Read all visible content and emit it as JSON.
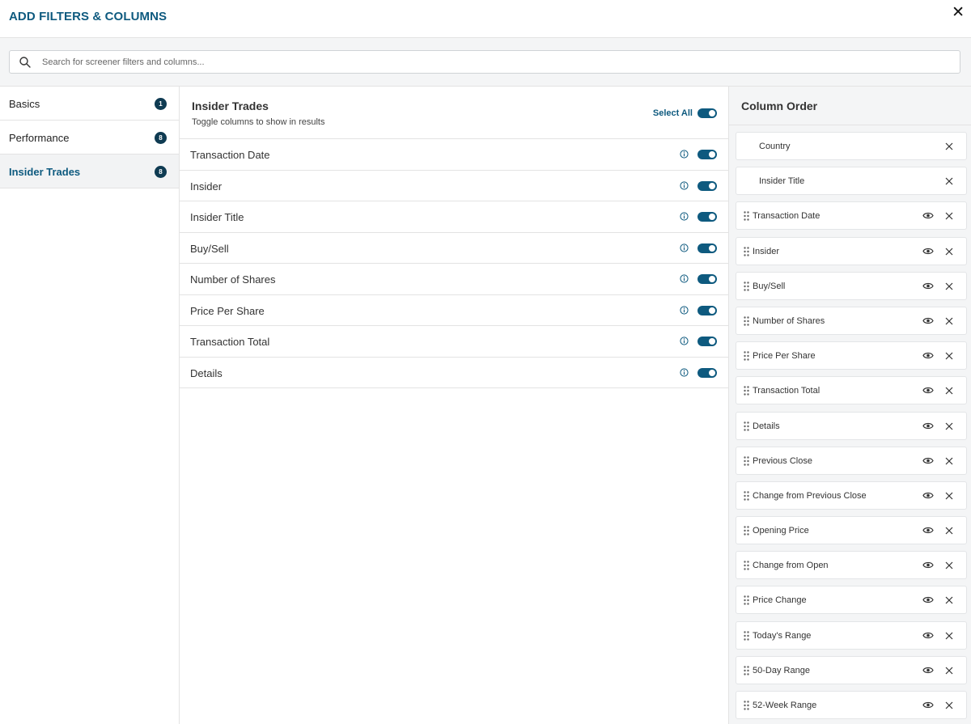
{
  "header": {
    "title": "ADD FILTERS & COLUMNS",
    "close_label": "✕"
  },
  "search": {
    "placeholder": "Search for screener filters and columns..."
  },
  "sidebar": {
    "items": [
      {
        "label": "Basics",
        "count": "1",
        "active": false
      },
      {
        "label": "Performance",
        "count": "8",
        "active": false
      },
      {
        "label": "Insider Trades",
        "count": "8",
        "active": true
      }
    ]
  },
  "middle": {
    "title": "Insider Trades",
    "subtitle": "Toggle columns to show in results",
    "select_all_label": "Select All",
    "columns": [
      {
        "label": "Transaction Date",
        "enabled": true
      },
      {
        "label": "Insider",
        "enabled": true
      },
      {
        "label": "Insider Title",
        "enabled": true
      },
      {
        "label": "Buy/Sell",
        "enabled": true
      },
      {
        "label": "Number of Shares",
        "enabled": true
      },
      {
        "label": "Price Per Share",
        "enabled": true
      },
      {
        "label": "Transaction Total",
        "enabled": true
      },
      {
        "label": "Details",
        "enabled": true
      }
    ]
  },
  "column_order": {
    "title": "Column Order",
    "items": [
      {
        "label": "Country",
        "locked": true
      },
      {
        "label": "Insider Title",
        "locked": true
      },
      {
        "label": "Transaction Date",
        "locked": false
      },
      {
        "label": "Insider",
        "locked": false
      },
      {
        "label": "Buy/Sell",
        "locked": false
      },
      {
        "label": "Number of Shares",
        "locked": false
      },
      {
        "label": "Price Per Share",
        "locked": false
      },
      {
        "label": "Transaction Total",
        "locked": false
      },
      {
        "label": "Details",
        "locked": false
      },
      {
        "label": "Previous Close",
        "locked": false
      },
      {
        "label": "Change from Previous Close",
        "locked": false
      },
      {
        "label": "Opening Price",
        "locked": false
      },
      {
        "label": "Change from Open",
        "locked": false
      },
      {
        "label": "Price Change",
        "locked": false
      },
      {
        "label": "Today's Range",
        "locked": false
      },
      {
        "label": "50-Day Range",
        "locked": false
      },
      {
        "label": "52-Week Range",
        "locked": false
      }
    ]
  },
  "icons": {
    "search": "search-icon",
    "close": "close-icon",
    "info": "info-icon",
    "drag": "drag-handle-icon",
    "eye": "eye-icon",
    "remove": "remove-icon"
  },
  "colors": {
    "accent": "#0e5a7f",
    "badge": "#0f3b52",
    "panel_bg": "#f4f5f6",
    "border": "#e3e3e3"
  }
}
